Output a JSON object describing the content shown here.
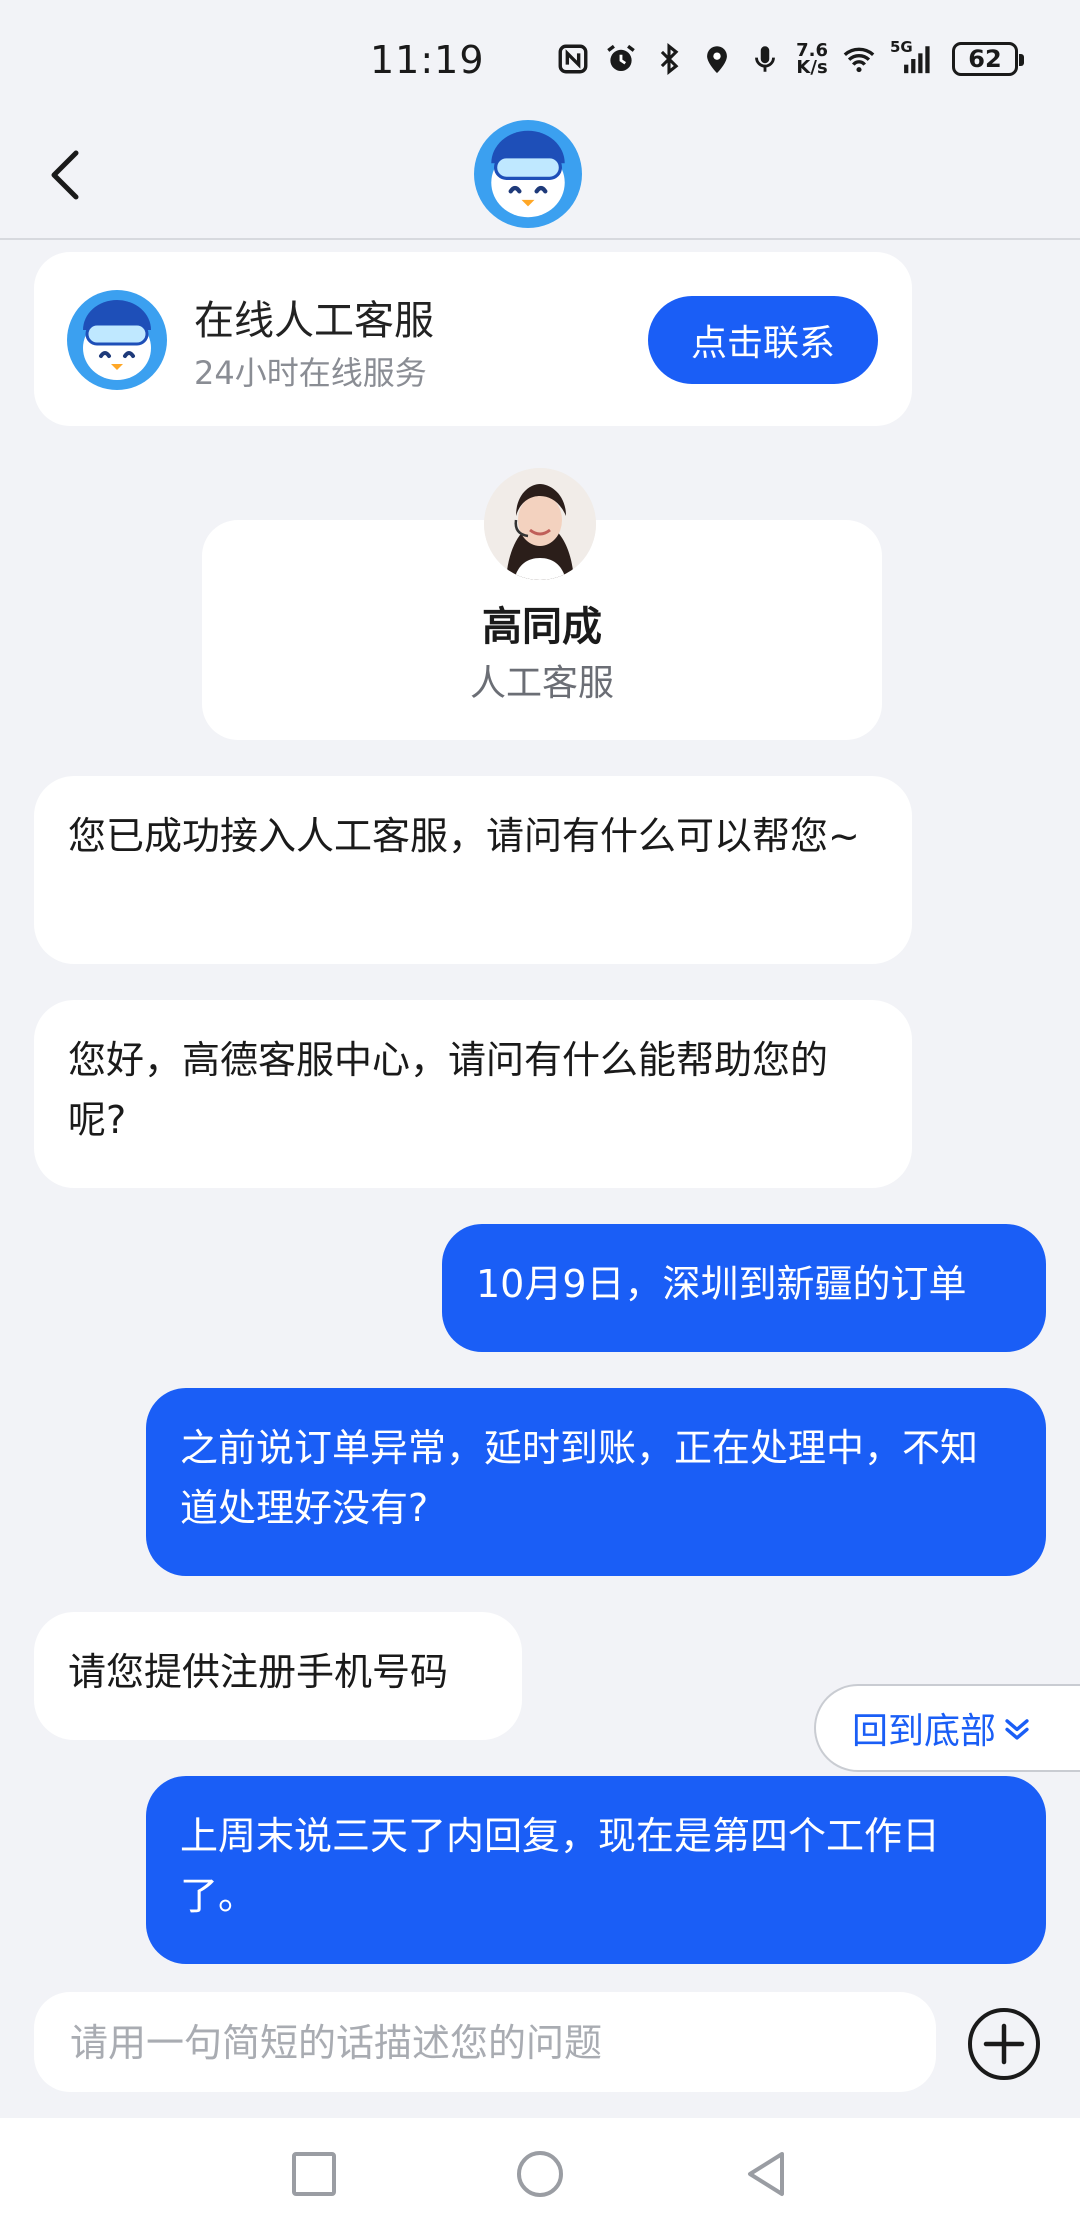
{
  "status_bar": {
    "time": "11:19",
    "net_speed_value": "7.6",
    "net_speed_unit": "K/s",
    "network_type": "5G",
    "battery_level": "62",
    "icons": [
      "nfc-icon",
      "alarm-icon",
      "bluetooth-icon",
      "location-icon",
      "microphone-icon",
      "wifi-icon",
      "cellular-signal-icon",
      "battery-icon"
    ]
  },
  "header": {
    "back_icon": "chevron-left-icon",
    "logo_icon": "penguin-mascot-icon"
  },
  "service_card": {
    "title": "在线人工客服",
    "subtitle": "24小时在线服务",
    "button_label": "点击联系"
  },
  "agent_card": {
    "name": "高同成",
    "role": "人工客服"
  },
  "messages": [
    {
      "from": "agent",
      "text": "您已成功接入人工客服，请问有什么可以帮您~"
    },
    {
      "from": "agent",
      "text": "您好，高德客服中心，请问有什么能帮助您的呢?"
    },
    {
      "from": "user",
      "text": "10月9日，深圳到新疆的订单"
    },
    {
      "from": "user",
      "text": "之前说订单异常，延时到账，正在处理中，不知道处理好没有?"
    },
    {
      "from": "agent",
      "text": "请您提供注册手机号码"
    },
    {
      "from": "user",
      "text": "上周末说三天了内回复，现在是第四个工作日了。"
    }
  ],
  "scroll_to_bottom": {
    "label": "回到底部"
  },
  "input": {
    "placeholder": "请用一句简短的话描述您的问题",
    "value": ""
  },
  "colors": {
    "accent": "#1a5ef6",
    "background": "#f2f3f7",
    "bubble_in": "#ffffff"
  }
}
